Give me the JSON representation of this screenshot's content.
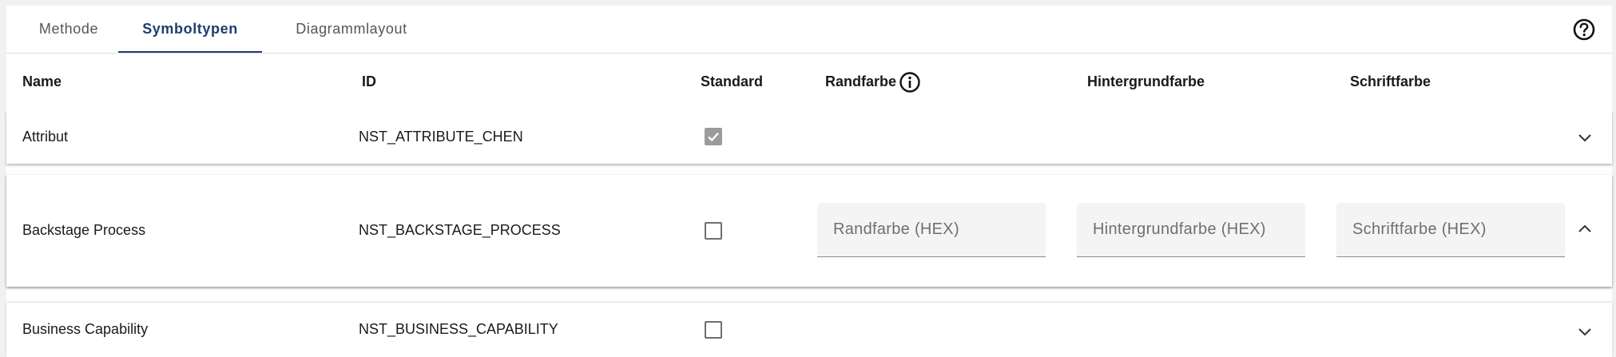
{
  "tabs": [
    {
      "label": "Methode",
      "active": false
    },
    {
      "label": "Symboltypen",
      "active": true
    },
    {
      "label": "Diagrammlayout",
      "active": false
    }
  ],
  "icons": {
    "help": "help-circle-icon",
    "info": "info-icon",
    "expand": "chevron-down-icon",
    "collapse": "chevron-up-icon",
    "check": "check-icon"
  },
  "colors": {
    "accent": "#1c3f6e",
    "checkbox_disabled": "#9b9b9b",
    "field_bg": "#f4f4f4"
  },
  "table": {
    "headers": {
      "name": "Name",
      "id": "ID",
      "standard": "Standard",
      "border_color": "Randfarbe",
      "background_color": "Hintergrundfarbe",
      "font_color": "Schriftfarbe"
    },
    "rows": [
      {
        "name": "Attribut",
        "id": "NST_ATTRIBUTE_CHEN",
        "standard": true,
        "standard_disabled": true,
        "expanded": false
      },
      {
        "name": "Backstage Process",
        "id": "NST_BACKSTAGE_PROCESS",
        "standard": false,
        "expanded": true,
        "fields": {
          "border_color": {
            "value": "",
            "placeholder": "Randfarbe (HEX)"
          },
          "background_color": {
            "value": "",
            "placeholder": "Hintergrundfarbe (HEX)"
          },
          "font_color": {
            "value": "",
            "placeholder": "Schriftfarbe (HEX)"
          }
        }
      },
      {
        "name": "Business Capability",
        "id": "NST_BUSINESS_CAPABILITY",
        "standard": false,
        "expanded": false
      }
    ]
  }
}
